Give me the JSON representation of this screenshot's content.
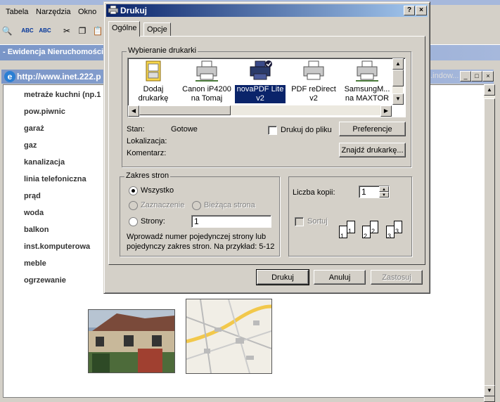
{
  "app": {
    "menu": [
      "Tabela",
      "Narzędzia",
      "Okno"
    ],
    "doc_title": "- Ewidencja Nieruchomości",
    "address_url": "http://www.inet.222.p",
    "browser_window_title": "...indow..."
  },
  "page": {
    "attributes": [
      "metraże kuchni (np.1",
      "pow.piwnic",
      "garaż",
      "gaz",
      "kanalizacja",
      "linia telefoniczna",
      "prąd",
      "woda",
      "balkon",
      "inst.komputerowa",
      "meble",
      "ogrzewanie"
    ]
  },
  "dialog": {
    "title": "Drukuj",
    "tabs": [
      "Ogólne",
      "Opcje"
    ],
    "printer_group": "Wybieranie drukarki",
    "printers": [
      {
        "line1": "Dodaj",
        "line2": "drukarkę"
      },
      {
        "line1": "Canon iP4200",
        "line2": "na Tomaj"
      },
      {
        "line1": "novaPDF Lite",
        "line2": "v2"
      },
      {
        "line1": "PDF reDirect",
        "line2": "v2"
      },
      {
        "line1": "SamsungM...",
        "line2": "na MAXTOR"
      }
    ],
    "status_label": "Stan:",
    "status_value": "Gotowe",
    "location_label": "Lokalizacja:",
    "comment_label": "Komentarz:",
    "print_to_file": "Drukuj do pliku",
    "preferences_btn": "Preferencje",
    "find_printer_btn": "Znajdź drukarkę...",
    "range_group": "Zakres stron",
    "range_all": "Wszystko",
    "range_selection": "Zaznaczenie",
    "range_current": "Bieżąca strona",
    "range_pages": "Strony:",
    "range_pages_value": "1",
    "range_hint_1": "Wprowadź numer pojedynczej strony lub",
    "range_hint_2": "pojedynczy zakres stron. Na przykład: 5-12",
    "copies_label": "Liczba kopii:",
    "copies_value": "1",
    "collate": "Sortuj",
    "copy_numbers": [
      "1",
      "1",
      "2",
      "2",
      "3",
      "3"
    ],
    "btn_print": "Drukuj",
    "btn_cancel": "Anuluj",
    "btn_apply": "Zastosuj",
    "btn_help": "?",
    "btn_close": "×"
  }
}
